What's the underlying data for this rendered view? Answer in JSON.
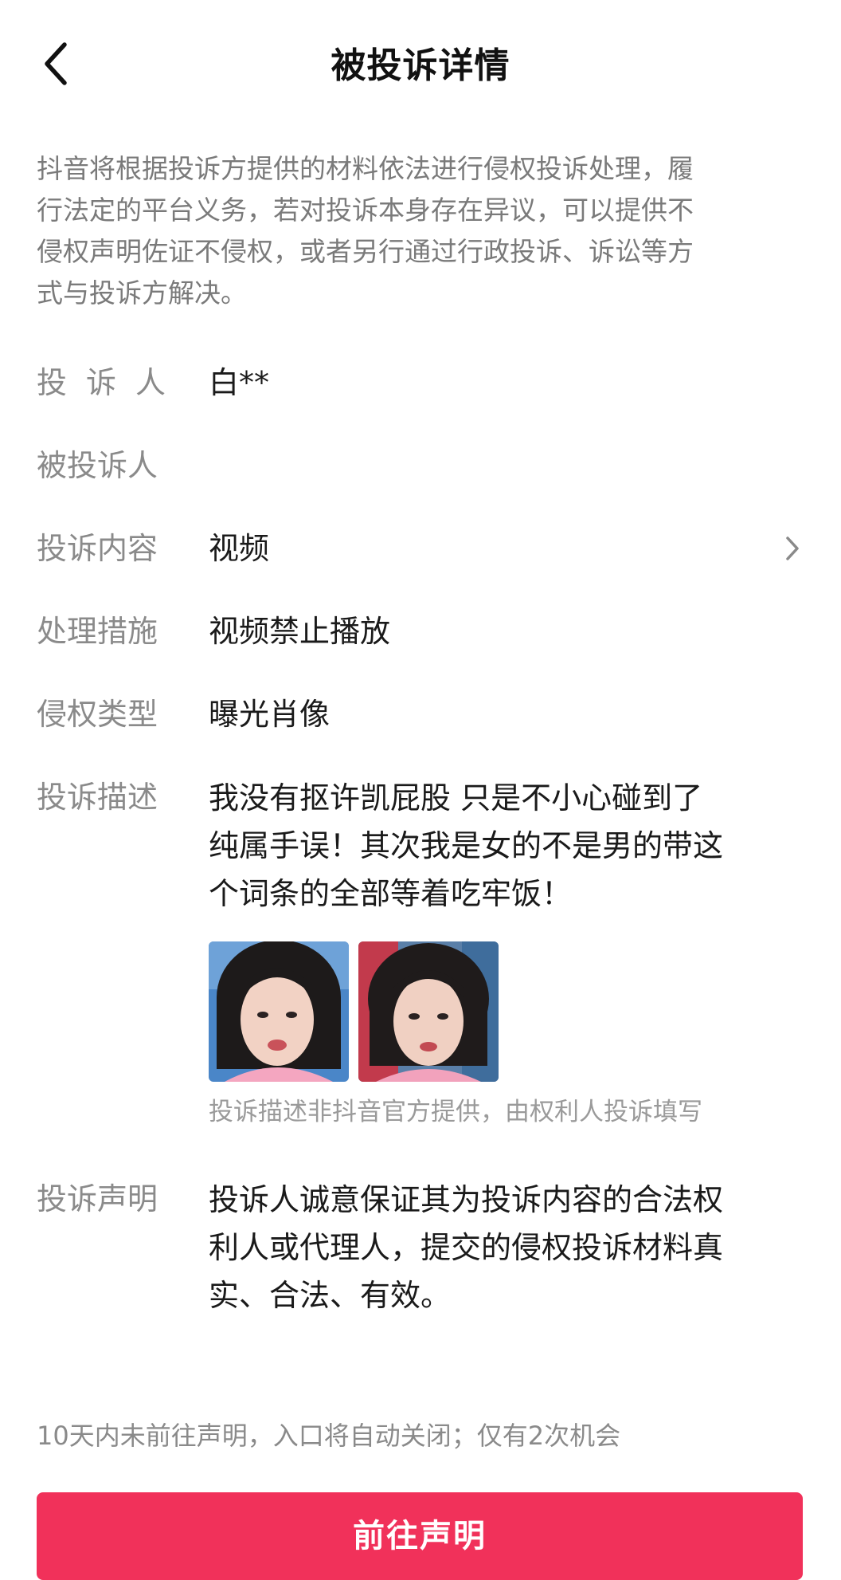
{
  "header": {
    "back_icon": "chevron-left-icon",
    "title": "被投诉详情"
  },
  "notice": {
    "lines": [
      "抖音将根据投诉方提供的材料依法进行侵权投诉处理，履",
      "行法定的平台义务，若对投诉本身存在异议，可以提供不",
      "侵权声明佐证不侵权，或者另行通过行政投诉、诉讼等方",
      "式与投诉方解决。"
    ]
  },
  "details": {
    "complainant": {
      "label": "投诉人",
      "value": "白**"
    },
    "respondent": {
      "label": "被投诉人",
      "value": ""
    },
    "content": {
      "label": "投诉内容",
      "value": "视频",
      "chevron_icon": "chevron-right-icon"
    },
    "measure": {
      "label": "处理措施",
      "value": "视频禁止播放"
    },
    "type": {
      "label": "侵权类型",
      "value": "曝光肖像"
    },
    "description": {
      "label": "投诉描述",
      "lines": [
        "我没有抠许凯屁股 只是不小心碰到了",
        "纯属手误！其次我是女的不是男的带这",
        "个词条的全部等着吃牢饭！"
      ],
      "images": [
        "evidence-photo-1",
        "evidence-photo-2"
      ],
      "disclaimer": "投诉描述非抖音官方提供，由权利人投诉填写"
    },
    "statement": {
      "label": "投诉声明",
      "lines": [
        "投诉人诚意保证其为投诉内容的合法权",
        "利人或代理人，提交的侵权投诉材料真",
        "实、合法、有效。"
      ]
    }
  },
  "footer": {
    "deadline_text": "10天内未前往声明，入口将自动关闭；仅有2次机会",
    "button_label": "前往声明"
  },
  "colors": {
    "accent": "#f1315a",
    "label": "#8a8a8a",
    "text": "#1a1a1a"
  }
}
